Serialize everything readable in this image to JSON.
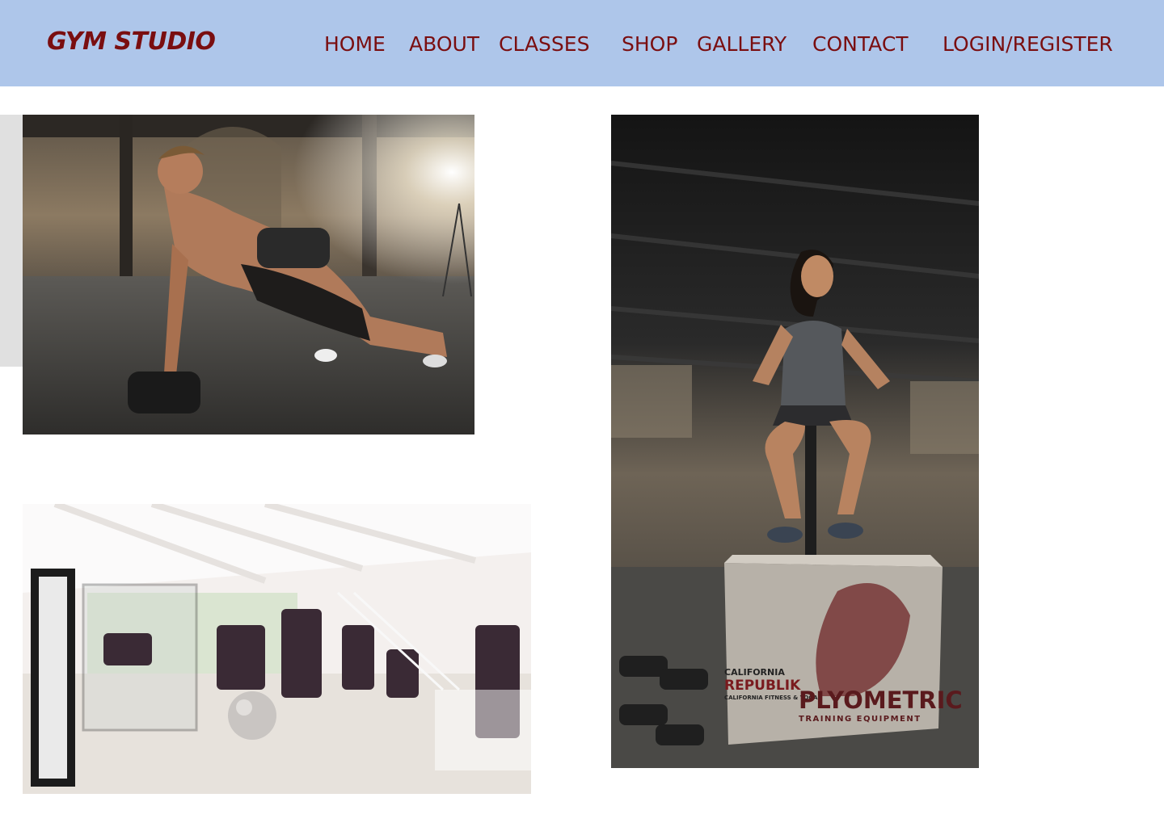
{
  "brand": "GYM STUDIO",
  "nav": {
    "home": "HOME",
    "about": "ABOUT",
    "classes": "CLASSES",
    "shop": "SHOP",
    "gallery": "GALLERY",
    "contact": "CONTACT",
    "login": "LOGIN/REGISTER"
  },
  "gallery": {
    "box_brand_top": "CALIFORNIA",
    "box_brand_main": "REPUBLIK",
    "box_brand_sub": "CALIFORNIA FITNESS & YOGA",
    "box_title": "PLYOMETRIC",
    "box_subtitle": "TRAINING EQUIPMENT"
  },
  "colors": {
    "header_bg": "#aec6ea",
    "brand_red": "#7a0e10"
  }
}
